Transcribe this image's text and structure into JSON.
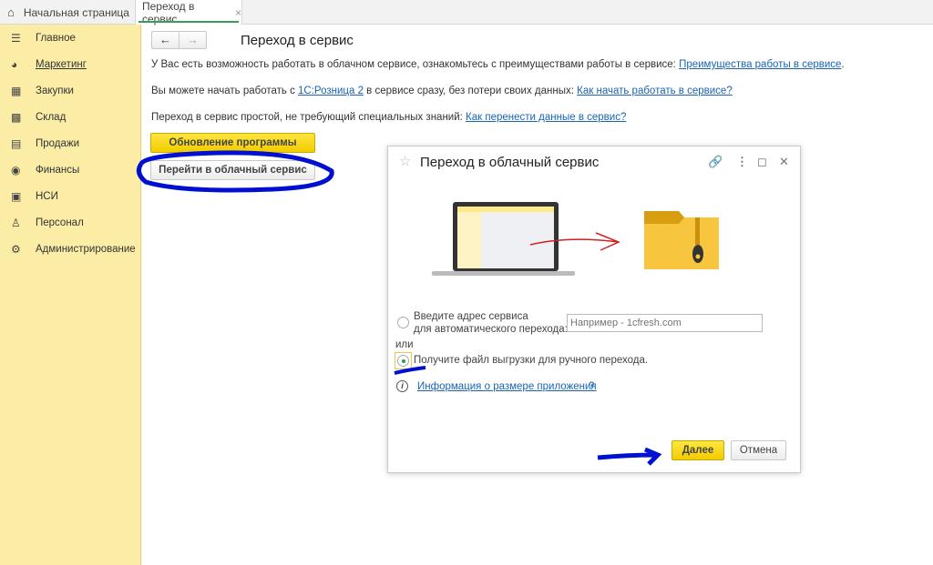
{
  "tabs": {
    "home": "Начальная страница",
    "active": "Переход в сервис",
    "close": "×"
  },
  "sidebar": {
    "items": [
      {
        "label": "Главное",
        "icon": "menu-icon"
      },
      {
        "label": "Маркетинг",
        "icon": "pie-chart-icon"
      },
      {
        "label": "Закупки",
        "icon": "cart-icon"
      },
      {
        "label": "Склад",
        "icon": "warehouse-icon"
      },
      {
        "label": "Продажи",
        "icon": "basket-icon"
      },
      {
        "label": "Финансы",
        "icon": "money-icon"
      },
      {
        "label": "НСИ",
        "icon": "documents-icon"
      },
      {
        "label": "Персонал",
        "icon": "person-icon"
      },
      {
        "label": "Администрирование",
        "icon": "gear-icon"
      }
    ]
  },
  "main": {
    "title": "Переход в сервис",
    "line1": {
      "text": "У Вас есть возможность работать в облачном сервисе, ознакомьтесь с преимуществами работы в сервисе: ",
      "link": "Преимущества работы в сервисе",
      "end": "."
    },
    "line2": {
      "text": "Вы можете начать работать с ",
      "link1": "1С:Розница 2",
      "mid": " в сервисе сразу, без потери своих данных: ",
      "link2": "Как начать работать в сервисе?"
    },
    "line3": {
      "text": "Переход в сервис простой, не требующий специальных знаний: ",
      "link": "Как перенести данные в сервис?"
    },
    "update_button": "Обновление программы",
    "cloud_button": "Перейти в облачный сервис"
  },
  "dialog": {
    "title": "Переход в облачный сервис",
    "option1_line1": "Введите адрес сервиса",
    "option1_line2": "для автоматического перехода:",
    "address_placeholder": "Например - 1cfresh.com",
    "or": "или",
    "option2": "Получите файл выгрузки для ручного перехода.",
    "info_link": "Информация о размере приложения",
    "help": "?",
    "next": "Далее",
    "cancel": "Отмена",
    "selected_option": 2
  }
}
